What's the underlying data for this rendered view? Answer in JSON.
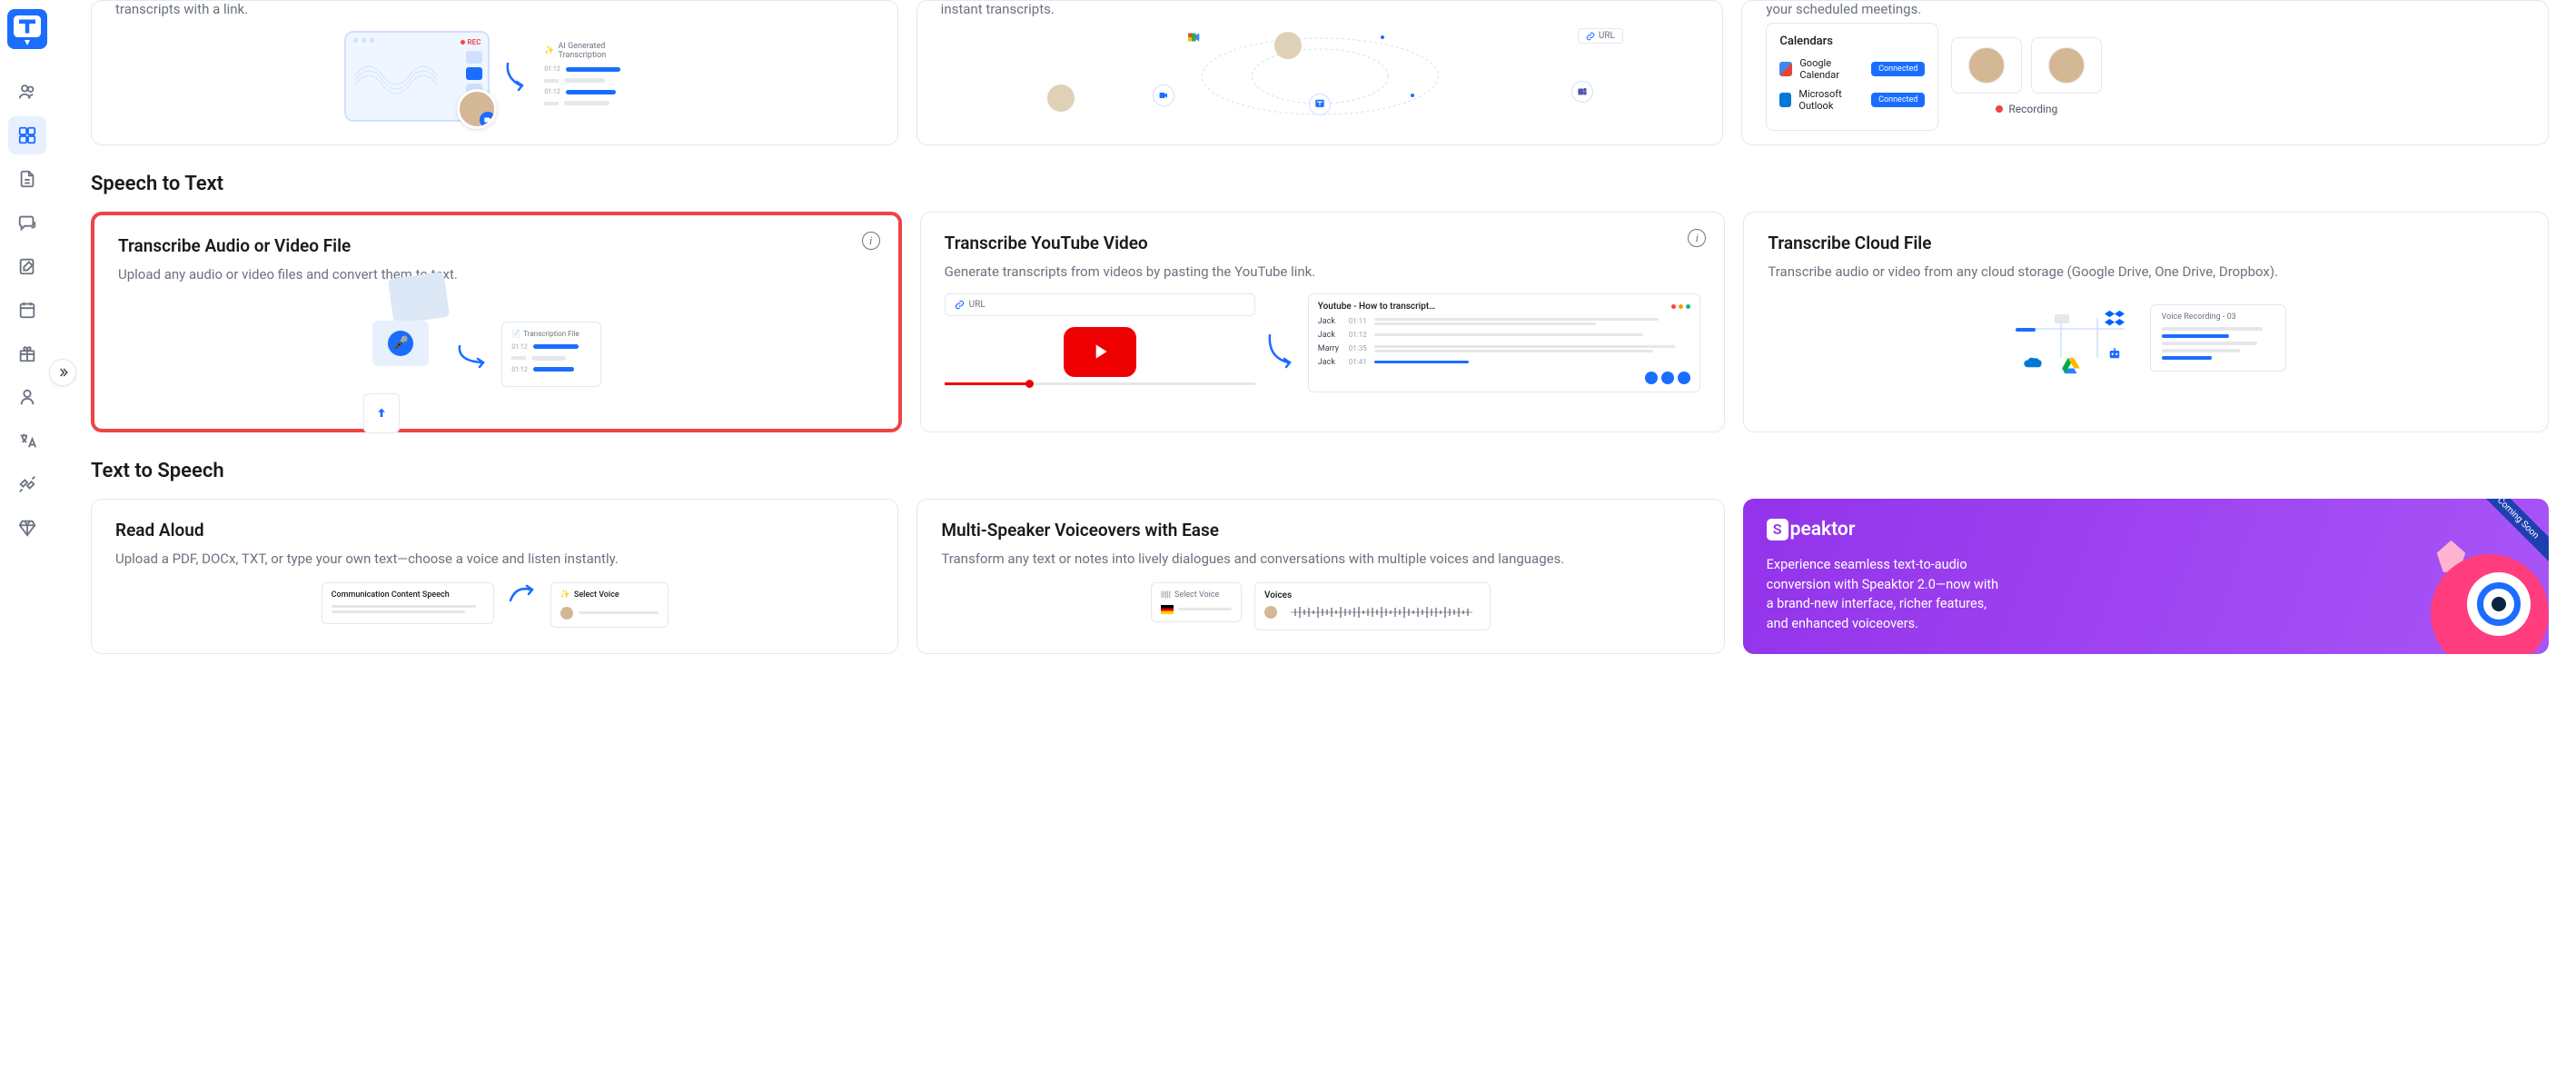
{
  "top_row": {
    "card1_desc_tail": "transcripts with a link.",
    "card1_rec": "REC",
    "card1_trans_label": "AI Generated Transcription",
    "card2_desc_tail": "instant transcripts.",
    "card2_url_label": "URL",
    "card3_desc_tail": "your scheduled meetings.",
    "card3_cal_title": "Calendars",
    "card3_google": "Google Calendar",
    "card3_outlook": "Microsoft Outlook",
    "card3_connected": "Connected",
    "card3_recording": "Recording"
  },
  "sections": {
    "stt": "Speech to Text",
    "tts": "Text to Speech"
  },
  "stt": {
    "card1_title": "Transcribe Audio or Video File",
    "card1_desc": "Upload any audio or video files and convert them to text.",
    "card1_trans_file": "Transcription File",
    "card1_times": [
      "01:12",
      "01:12"
    ],
    "card2_title": "Transcribe YouTube Video",
    "card2_desc": "Generate transcripts from videos by pasting the YouTube link.",
    "card2_url": "URL",
    "card2_panel_title": "Youtube - How to transcript…",
    "card2_speakers": [
      {
        "name": "Jack",
        "time": "01:11"
      },
      {
        "name": "Jack",
        "time": "01:12"
      },
      {
        "name": "Marry",
        "time": "01:35"
      },
      {
        "name": "Jack",
        "time": "01:41"
      }
    ],
    "card3_title": "Transcribe Cloud File",
    "card3_desc": "Transcribe audio or video from any cloud storage (Google Drive, One Drive, Dropbox).",
    "card3_vr_title": "Voice Recording - 03"
  },
  "tts": {
    "card1_title": "Read Aloud",
    "card1_desc": "Upload a PDF, DOCx, TXT, or type your own text—choose a voice and listen instantly.",
    "card1_doc_title": "Communication Content Speech",
    "card1_voice_title": "Select Voice",
    "card2_title": "Multi-Speaker Voiceovers with Ease",
    "card2_desc": "Transform any text or notes into lively dialogues and conversations with multiple voices and languages.",
    "card2_sv_title": "Select Voice",
    "card2_voices_title": "Voices",
    "speaktor_brand": "peaktor",
    "speaktor_desc": "Experience seamless text-to-audio conversion with Speaktor 2.0—now with a brand-new interface, richer features, and enhanced voiceovers.",
    "speaktor_badge": "Coming Soon"
  }
}
